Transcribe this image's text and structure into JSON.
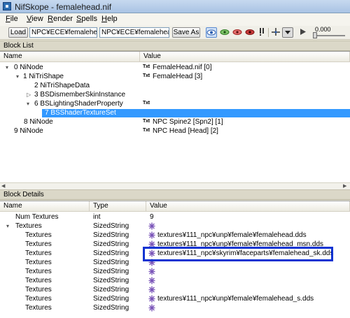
{
  "window": {
    "title": "NifSkope - femalehead.nif"
  },
  "menu": {
    "file": {
      "ul": "F",
      "rest": "ile"
    },
    "view": {
      "ul": "V",
      "rest": "iew"
    },
    "render": {
      "ul": "R",
      "rest": "ender"
    },
    "spells": {
      "ul": "S",
      "rest": "pells"
    },
    "help": {
      "ul": "H",
      "rest": "elp"
    }
  },
  "toolbar": {
    "load_label": "Load",
    "load_path": "NPC¥ECE¥femalehead.nif",
    "save_path": "NPC¥ECE¥femalehead.nif",
    "save_label": "Save As",
    "slider_value": "0.000",
    "accent": "#3b7ddd"
  },
  "block_list": {
    "title": "Block List",
    "columns": [
      "Name",
      "Value"
    ],
    "rows": [
      {
        "expander": "▾",
        "name": "0 NiNode",
        "type_tag": "Txt",
        "value": "FemaleHead.nif [0]"
      },
      {
        "expander": "▾",
        "name": "1 NiTriShape",
        "type_tag": "Txt",
        "value": "FemaleHead [3]"
      },
      {
        "expander": "",
        "name": "2 NiTriShapeData",
        "type_tag": "",
        "value": ""
      },
      {
        "expander": "▷",
        "name": "3 BSDismemberSkinInstance",
        "type_tag": "",
        "value": ""
      },
      {
        "expander": "▾",
        "name": "6 BSLightingShaderProperty",
        "type_tag": "Txt",
        "value": ""
      },
      {
        "expander": "",
        "name": "7 BSShaderTextureSet",
        "type_tag": "",
        "value": ""
      },
      {
        "expander": "",
        "name": "8 NiNode",
        "type_tag": "Txt",
        "value": "NPC Spine2 [Spn2] [1]"
      },
      {
        "expander": "",
        "name": "9 NiNode",
        "type_tag": "Txt",
        "value": "NPC Head [Head] [2]"
      }
    ],
    "selected_index": 5
  },
  "block_details": {
    "title": "Block Details",
    "columns": [
      "Name",
      "Type",
      "Value"
    ],
    "rows": [
      {
        "expander": "",
        "name": "Num Textures",
        "type": "int",
        "icon": "",
        "value": "9"
      },
      {
        "expander": "▾",
        "name": "Textures",
        "type": "SizedString",
        "icon": "star",
        "value": ""
      },
      {
        "expander": "",
        "name": "Textures",
        "type": "SizedString",
        "icon": "star",
        "value": "textures¥111_npc¥unp¥female¥femalehead.dds"
      },
      {
        "expander": "",
        "name": "Textures",
        "type": "SizedString",
        "icon": "star",
        "value": "textures¥111_npc¥unp¥female¥femalehead_msn.dds"
      },
      {
        "expander": "",
        "name": "Textures",
        "type": "SizedString",
        "icon": "star",
        "value": "textures¥111_npc¥skyrim¥faceparts¥femalehead_sk.dds"
      },
      {
        "expander": "",
        "name": "Textures",
        "type": "SizedString",
        "icon": "star",
        "value": ""
      },
      {
        "expander": "",
        "name": "Textures",
        "type": "SizedString",
        "icon": "star",
        "value": ""
      },
      {
        "expander": "",
        "name": "Textures",
        "type": "SizedString",
        "icon": "star",
        "value": ""
      },
      {
        "expander": "",
        "name": "Textures",
        "type": "SizedString",
        "icon": "star",
        "value": ""
      },
      {
        "expander": "",
        "name": "Textures",
        "type": "SizedString",
        "icon": "star",
        "value": "textures¥111_npc¥unp¥female¥femalehead_s.dds"
      },
      {
        "expander": "",
        "name": "Textures",
        "type": "SizedString",
        "icon": "star",
        "value": ""
      }
    ],
    "highlight_color": "#1033d2"
  }
}
